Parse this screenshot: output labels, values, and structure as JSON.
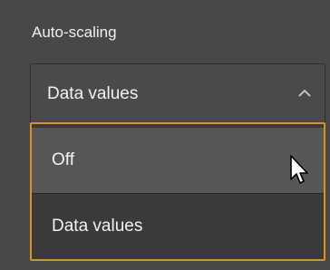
{
  "section": {
    "label": "Auto-scaling"
  },
  "select": {
    "value": "Data values",
    "chevron_icon": "chevron-up-icon",
    "expanded": true
  },
  "dropdown": {
    "options": [
      {
        "label": "Off",
        "hovered": true
      },
      {
        "label": "Data values",
        "hovered": false
      }
    ]
  },
  "colors": {
    "panel_bg": "#484848",
    "dropdown_border": "#e0911c",
    "hover_bg": "#575757",
    "text": "#f2f2f2"
  },
  "cursor_icon": "mouse-pointer-icon"
}
